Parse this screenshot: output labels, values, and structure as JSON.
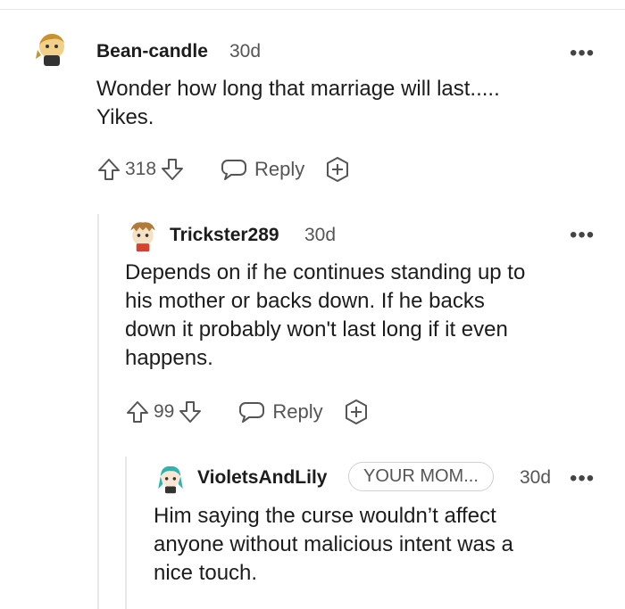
{
  "comments": [
    {
      "author": "Bean-candle",
      "age": "30d",
      "text_lines": [
        "Wonder how long that marriage will last.....",
        "Yikes."
      ],
      "votes": "318",
      "reply_label": "Reply",
      "more_label": "•••"
    },
    {
      "author": "Trickster289",
      "age": "30d",
      "text_lines": [
        "Depends on if he continues standing up to",
        "his mother or backs down. If he backs",
        "down it probably won't last long if it even",
        "happens."
      ],
      "votes": "99",
      "reply_label": "Reply",
      "more_label": "•••"
    },
    {
      "author": "VioletsAndLily",
      "flair": "YOUR MOM...",
      "age": "30d",
      "text_lines": [
        "Him saying the curse wouldn’t affect",
        "anyone without malicious intent was a",
        "nice touch."
      ],
      "more_label": "•••"
    }
  ],
  "icons": {
    "upvote": "upvote-icon",
    "downvote": "downvote-icon",
    "reply": "speech-bubble-icon",
    "award": "award-plus-icon",
    "more": "more-options-icon"
  }
}
